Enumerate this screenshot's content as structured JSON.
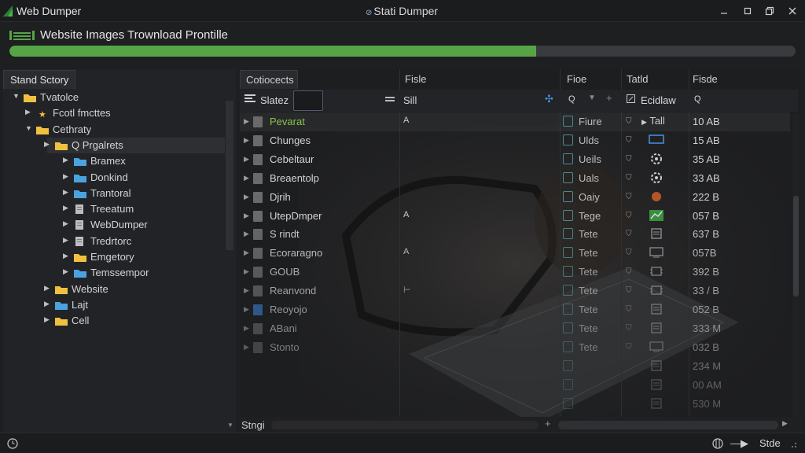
{
  "window": {
    "app_title": "Web Dumper",
    "center_title": "Stati Dumper",
    "controls": [
      "minimize-icon",
      "restore-icon",
      "maximize-icon",
      "close-icon"
    ]
  },
  "progress": {
    "title": "Website Images Trownload Prontille",
    "fraction": 0.67,
    "color": "#57a447"
  },
  "left_panel": {
    "tab": "Stand Sctory",
    "tree": [
      {
        "label": "Tvatolce",
        "depth": 0,
        "expanded": true,
        "icon": "folder-icon"
      },
      {
        "label": "Fcotl fmcttes",
        "depth": 1,
        "expanded": false,
        "icon": "star-folder-icon"
      },
      {
        "label": "Cethraty",
        "depth": 1,
        "expanded": true,
        "icon": "folder-icon"
      },
      {
        "label": "Q Prgalrets",
        "depth": 2,
        "expanded": false,
        "icon": "folder-icon",
        "selected": true
      },
      {
        "label": "Bramex",
        "depth": 3,
        "expanded": false,
        "icon": "blue-folder-icon"
      },
      {
        "label": "Donkind",
        "depth": 3,
        "expanded": false,
        "icon": "blue-folder-icon"
      },
      {
        "label": "Trantoral",
        "depth": 3,
        "expanded": false,
        "icon": "blue-folder-icon"
      },
      {
        "label": "Treeatum",
        "depth": 3,
        "expanded": false,
        "icon": "file-icon"
      },
      {
        "label": "WebDumper",
        "depth": 3,
        "expanded": false,
        "icon": "file-icon"
      },
      {
        "label": "Tredrtorc",
        "depth": 3,
        "expanded": false,
        "icon": "file-icon"
      },
      {
        "label": "Emgetory",
        "depth": 3,
        "expanded": false,
        "icon": "folder-icon"
      },
      {
        "label": "Temssempor",
        "depth": 3,
        "expanded": false,
        "icon": "blue-folder-icon"
      },
      {
        "label": "Website",
        "depth": 2,
        "expanded": false,
        "icon": "folder-icon"
      },
      {
        "label": "Lajt",
        "depth": 2,
        "expanded": false,
        "icon": "blue-folder-icon"
      },
      {
        "label": "Cell",
        "depth": 2,
        "expanded": false,
        "icon": "folder-icon"
      }
    ]
  },
  "table": {
    "columns": [
      "Cotiocects",
      "Fisle",
      "Fioe",
      "Tatld",
      "Fisde"
    ],
    "filter": {
      "label": "Slatez",
      "col2_text": "Sill",
      "col3_icons": [
        "search-icon",
        "chevron-down-icon",
        "plus-icon"
      ],
      "col4_text": "Ecidlaw",
      "col5_icon": "search-icon"
    },
    "rows": [
      {
        "name": "Pevarat",
        "mark": "A",
        "type": "Fiure",
        "thumb": "play-tail",
        "thumb_text": "Tall",
        "size": "10 AB",
        "name_color": "#8bc34a"
      },
      {
        "name": "Chunges",
        "mark": "",
        "type": "Ulds",
        "thumb": "rect",
        "size": "15 AB"
      },
      {
        "name": "Cebeltaur",
        "mark": "",
        "type": "Ueils",
        "thumb": "gear",
        "size": "35 AB"
      },
      {
        "name": "Breaentolp",
        "mark": "",
        "type": "Uals",
        "thumb": "gear",
        "size": "33 AB"
      },
      {
        "name": "Djrih",
        "mark": "",
        "type": "Oaiy",
        "thumb": "orange-circle",
        "size": "222 B"
      },
      {
        "name": "UtepDmper",
        "mark": "A",
        "type": "Tege",
        "thumb": "green-chart",
        "size": "057 B"
      },
      {
        "name": "S rindt",
        "mark": "",
        "type": "Tete",
        "thumb": "doc",
        "size": "637 B"
      },
      {
        "name": "Ecoraragno",
        "mark": "A",
        "type": "Tete",
        "thumb": "monitor",
        "size": "057B"
      },
      {
        "name": "GOUB",
        "mark": "",
        "type": "Tete",
        "thumb": "chip",
        "size": "392 B"
      },
      {
        "name": "Reanvond",
        "mark": "⊢",
        "type": "Tete",
        "thumb": "chip",
        "size": "33 / B"
      },
      {
        "name": "Reoyojo",
        "mark": "",
        "type": "Tete",
        "thumb": "doc",
        "size": "052 B"
      },
      {
        "name": "ABani",
        "mark": "",
        "type": "Tete",
        "thumb": "doc",
        "size": "333 M"
      },
      {
        "name": "Stonto",
        "mark": "",
        "type": "Tete",
        "thumb": "monitor",
        "size": "032 B"
      },
      {
        "name": "",
        "mark": "",
        "type": "",
        "thumb": "doc",
        "size": "234 M"
      },
      {
        "name": "",
        "mark": "",
        "type": "",
        "thumb": "doc",
        "size": "00 AM"
      },
      {
        "name": "",
        "mark": "",
        "type": "",
        "thumb": "doc",
        "size": "530 M"
      }
    ]
  },
  "bottom": {
    "left_label": "Stngi",
    "status_right": "Stde"
  }
}
